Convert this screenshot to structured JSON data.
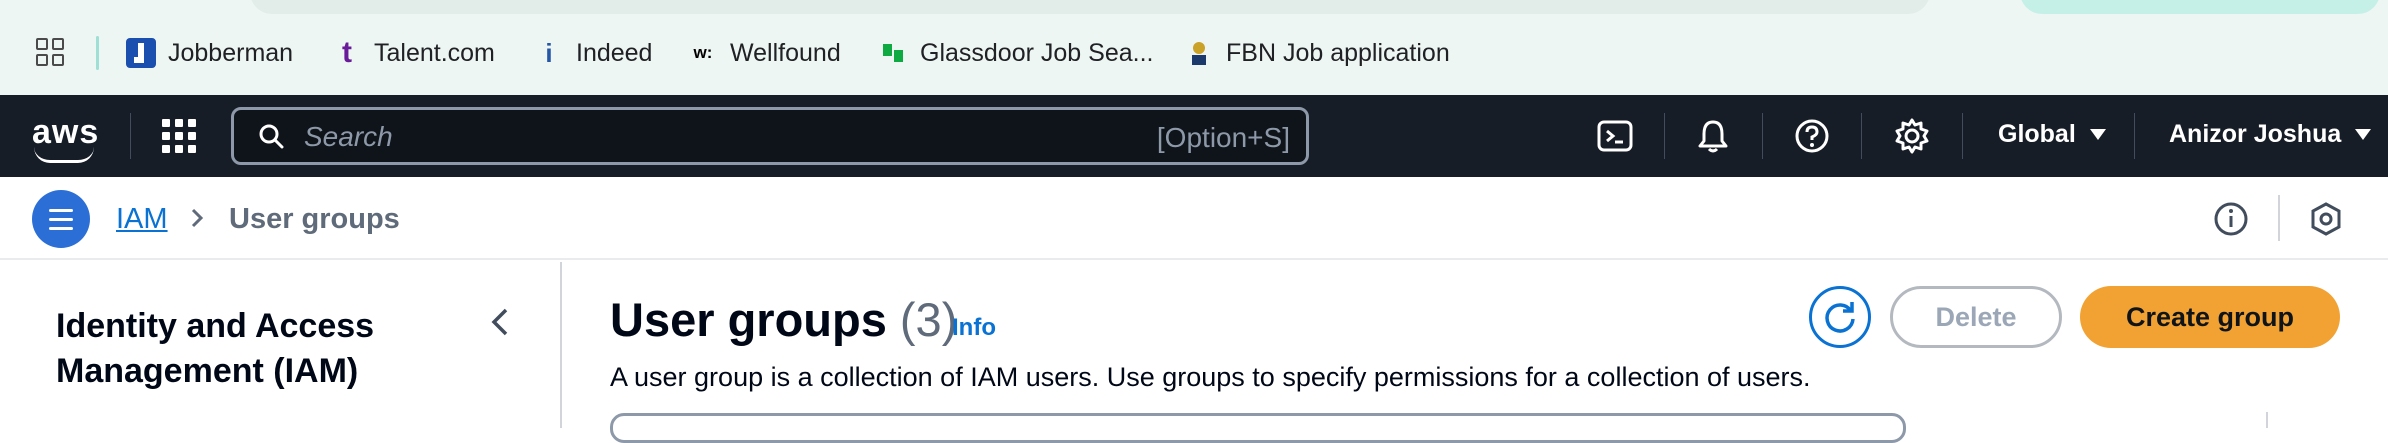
{
  "bookmarks": {
    "items": [
      {
        "label": "Jobberman",
        "icon": "jobberman-icon",
        "color": "#1a4fb0"
      },
      {
        "label": "Talent.com",
        "icon": "talent-icon",
        "color": "#6a1b9a"
      },
      {
        "label": "Indeed",
        "icon": "indeed-icon",
        "color": "#2557a7"
      },
      {
        "label": "Wellfound",
        "icon": "wellfound-icon",
        "color": "#000000"
      },
      {
        "label": "Glassdoor Job Sea...",
        "icon": "glassdoor-icon",
        "color": "#0caa41"
      },
      {
        "label": "FBN Job application",
        "icon": "fbn-icon",
        "color": "#1b3a6b"
      }
    ]
  },
  "nav": {
    "logo": "aws",
    "search_placeholder": "Search",
    "search_shortcut": "[Option+S]",
    "region": "Global",
    "account": "Anizor Joshua",
    "icons": [
      "cloudshell-icon",
      "bell-icon",
      "help-icon",
      "gear-icon"
    ]
  },
  "breadcrumb": {
    "root": "IAM",
    "current": "User groups"
  },
  "sidenav": {
    "title": "Identity and Access Management (IAM)"
  },
  "main": {
    "title": "User groups",
    "count": "(3)",
    "info_label": "Info",
    "description": "A user group is a collection of IAM users. Use groups to specify permissions for a collection of users.",
    "delete_label": "Delete",
    "create_label": "Create group"
  },
  "colors": {
    "nav_bg": "#161d26",
    "link": "#0972d3",
    "primary_button": "#f2a232",
    "bookmark_bar": "#eef6f3"
  }
}
